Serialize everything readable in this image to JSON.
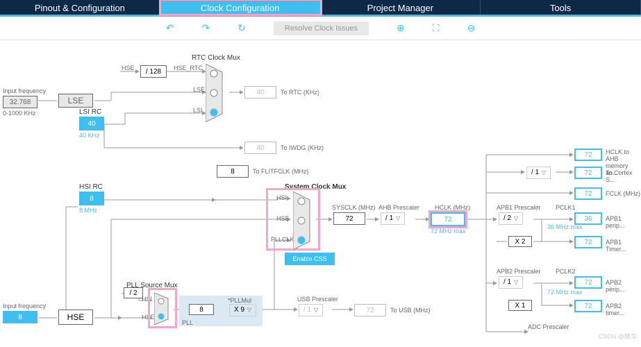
{
  "nav": {
    "tabs": [
      "Pinout & Configuration",
      "Clock Configuration",
      "Project Manager",
      "Tools"
    ],
    "active": 1
  },
  "toolbar": {
    "resolve": "Resolve Clock Issues"
  },
  "inputs": {
    "input_freq_label": "Input frequency",
    "lse_freq": "32.768",
    "lse_range": "0-1000 KHz",
    "hse_freq": "8",
    "lse_name": "LSE",
    "hse_name": "HSE",
    "lsi_rc_label": "LSI RC",
    "lsi_freq": "40",
    "lsi_unit": "40 KHz",
    "hsi_rc_label": "HSI RC",
    "hsi_freq": "8",
    "hsi_unit": "8 MHz"
  },
  "dividers": {
    "hse_rtc_div": "/ 128",
    "hse_rtc_label": "HSE_RTC",
    "hse_label": "HSE",
    "pll_div": "/ 2",
    "pllmul_label": "*PLLMul",
    "pllmul_val": "X 9",
    "pll_in": "8"
  },
  "mux": {
    "rtc_title": "RTC Clock Mux",
    "rtc_in": [
      "HSE",
      "LSE",
      "LSI"
    ],
    "sys_title": "System Clock Mux",
    "sys_in": [
      "HSI",
      "HSE",
      "PLLCLK"
    ],
    "enable_css": "Enable CSS",
    "pll_src_title": "PLL Source Mux",
    "pll_src_in": [
      "HSI",
      "HSE"
    ],
    "pll_label": "PLL"
  },
  "outputs": {
    "to_rtc": "To RTC (KHz)",
    "rtc_val": "40",
    "to_iwdg": "To IWDG (KHz)",
    "iwdg_val": "40",
    "to_flitfclk": "To FLITFCLK (MHz)",
    "flitfclk_val": "8",
    "sysclk_label": "SYSCLK (MHz)",
    "sysclk_val": "72",
    "ahb_label": "AHB Prescaler",
    "ahb_val": "/ 1",
    "hclk_label": "HCLK (MHz)",
    "hclk_val": "72",
    "hclk_max": "72 MHz max",
    "usb_presc_label": "USB Prescaler",
    "usb_presc_val": "/ 1",
    "to_usb": "To USB (MHz)",
    "usb_val": "72"
  },
  "right": {
    "hclk_to_ahb": "HCLK to AHB memory an...",
    "hclk_to_ahb_val": "72",
    "div1": "/ 1",
    "to_cortex": "To Cortex S...",
    "cortex_val": "72",
    "fclk": "FCLK (MHz)",
    "fclk_val": "72",
    "apb1_presc_label": "APB1 Prescaler",
    "apb1_presc": "/ 2",
    "pclk1_label": "PCLK1",
    "pclk1_note": "36 MHz max",
    "apb1_periph": "APB1 perip...",
    "apb1_periph_val": "36",
    "apb1_timer_mul": "X 2",
    "apb1_timer": "APB1 Timer...",
    "apb1_timer_val": "72",
    "apb2_presc_label": "APB2 Prescaler",
    "apb2_presc": "/ 1",
    "pclk2_label": "PCLK2",
    "pclk2_note": "72 MHz max",
    "apb2_periph": "APB2 perip...",
    "apb2_periph_val": "72",
    "apb2_timer_mul": "X 1",
    "apb2_timer": "APB2 timer...",
    "apb2_timer_val": "72",
    "adc_presc_label": "ADC Prescaler"
  },
  "watermark": "CSDN @姚华"
}
